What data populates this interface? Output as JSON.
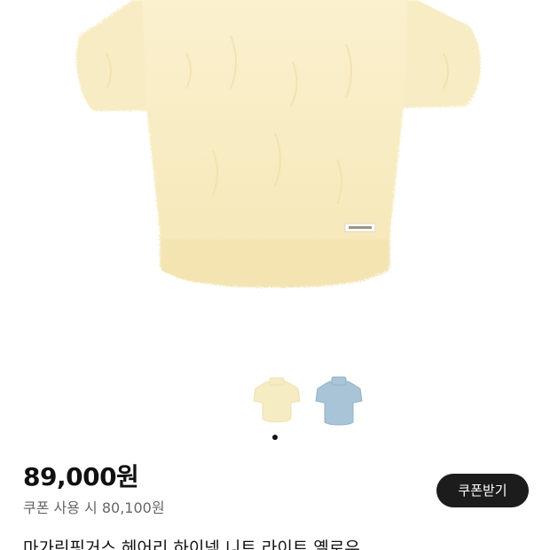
{
  "product": {
    "price": "89,000원",
    "coupon_price_text": "쿠폰 사용 시 80,100원",
    "coupon_button_label": "쿠폰받기",
    "title": "마가린핑거스 헤어리 하이넥 니트 라이트 옐로우"
  },
  "gallery": {
    "main_image_icon": "sweater-photo",
    "colors": {
      "yellow": "#f6ecc4",
      "blue": "#a9c4d6"
    },
    "thumbnails": [
      {
        "name": "yellow-sweater-thumbnail",
        "color": "#f6ecc4"
      },
      {
        "name": "blue-sweater-thumbnail",
        "color": "#a9c4d6"
      }
    ],
    "current_page": 1,
    "page_count": 1
  }
}
